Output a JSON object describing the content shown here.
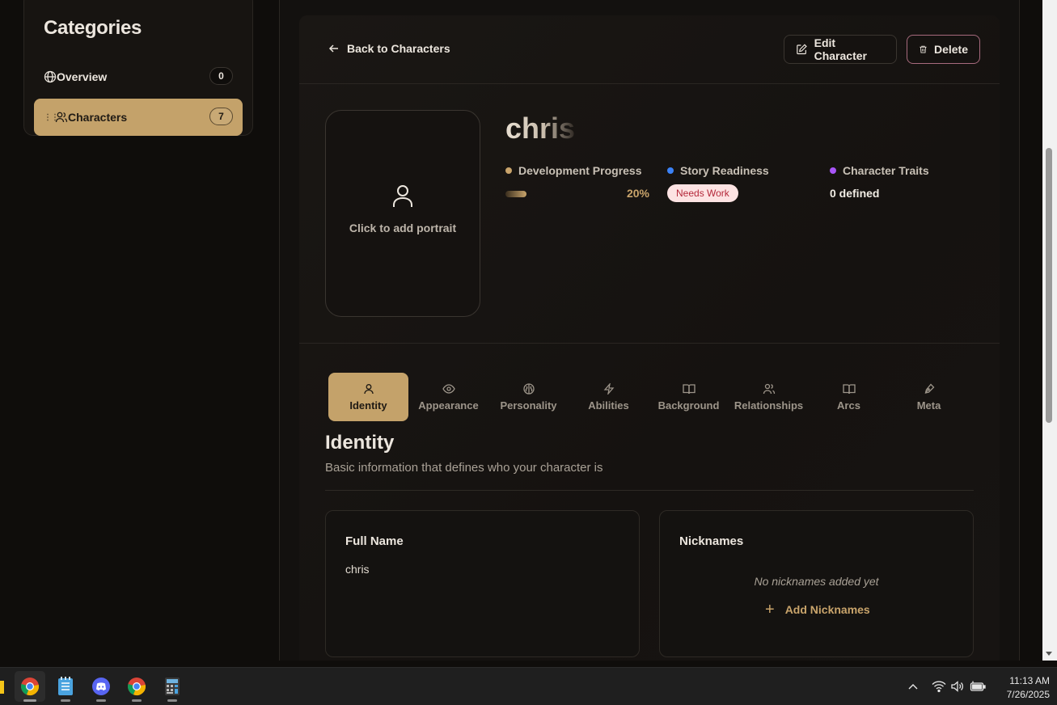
{
  "sidebar": {
    "title": "Categories",
    "items": [
      {
        "label": "Overview",
        "count": "0",
        "icon": "globe-icon"
      },
      {
        "label": "Characters",
        "count": "7",
        "icon": "users-icon",
        "active": true
      }
    ]
  },
  "toolbar": {
    "back_label": "Back to Characters",
    "edit_label": "Edit Character",
    "delete_label": "Delete"
  },
  "character": {
    "name": "chris",
    "portrait_prompt": "Click to add portrait"
  },
  "stats": {
    "development": {
      "label": "Development Progress",
      "value": "20%",
      "fraction": 0.2,
      "dot_color": "#c9a46b"
    },
    "readiness": {
      "label": "Story Readiness",
      "badge": "Needs Work",
      "dot_color": "#3b82f6"
    },
    "traits": {
      "label": "Character Traits",
      "value": "0 defined",
      "dot_color": "#a855f7"
    }
  },
  "tabs": [
    {
      "label": "Identity",
      "icon": "person-icon",
      "active": true
    },
    {
      "label": "Appearance",
      "icon": "eye-icon"
    },
    {
      "label": "Personality",
      "icon": "brain-icon"
    },
    {
      "label": "Abilities",
      "icon": "lightning-icon"
    },
    {
      "label": "Background",
      "icon": "book-icon"
    },
    {
      "label": "Relationships",
      "icon": "users-icon"
    },
    {
      "label": "Arcs",
      "icon": "book-open-icon"
    },
    {
      "label": "Meta",
      "icon": "pen-icon"
    }
  ],
  "section": {
    "title": "Identity",
    "subtitle": "Basic information that defines who your character is"
  },
  "fields": {
    "full_name": {
      "title": "Full Name",
      "value": "chris"
    },
    "nicknames": {
      "title": "Nicknames",
      "empty_text": "No nicknames added yet",
      "add_label": "Add Nicknames"
    }
  },
  "taskbar": {
    "apps": [
      "chrome-icon",
      "notepad-icon",
      "discord-icon",
      "chrome-icon",
      "calculator-icon"
    ],
    "time": "11:13 AM",
    "date": "7/26/2025"
  },
  "colors": {
    "accent": "#c4a26a",
    "background": "#0f0d0b",
    "danger_border": "#a76a7d"
  }
}
